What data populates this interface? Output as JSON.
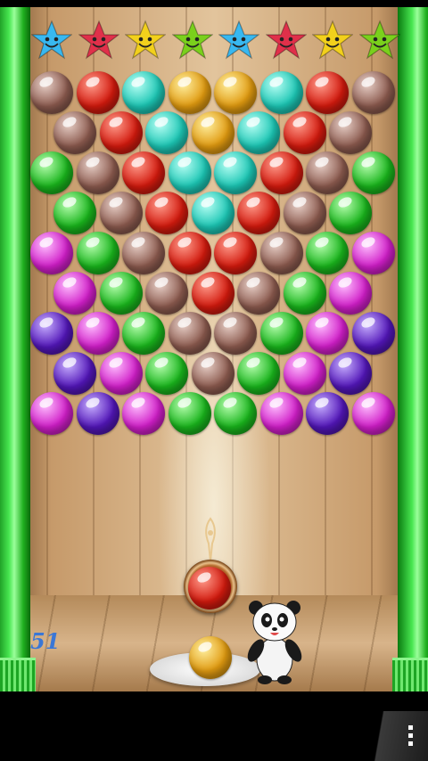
{
  "hud": {
    "shots_left": "51"
  },
  "stars": [
    "blue",
    "red",
    "yellow",
    "green",
    "blue",
    "red",
    "yellow",
    "green"
  ],
  "palette": {
    "brown": [
      "#e8d0c8",
      "#8b5a4e"
    ],
    "red": [
      "#ff9c8c",
      "#d21a0e"
    ],
    "teal": [
      "#b8fff4",
      "#1cc6b4"
    ],
    "gold": [
      "#fff0a0",
      "#e09a10"
    ],
    "green": [
      "#b8ffb0",
      "#19b41c"
    ],
    "magenta": [
      "#ffc0ff",
      "#d01ec8"
    ],
    "purple": [
      "#c8b0ff",
      "#5216b8"
    ],
    "star_blue": "#38b8f0",
    "star_red": "#e0304a",
    "star_yellow": "#f2d01c",
    "star_green": "#7ad01c"
  },
  "grid": [
    [
      "brown",
      "red",
      "teal",
      "gold",
      "gold",
      "teal",
      "red",
      "brown"
    ],
    [
      "brown",
      "red",
      "teal",
      "gold",
      "teal",
      "red",
      "brown"
    ],
    [
      "green",
      "brown",
      "red",
      "teal",
      "teal",
      "red",
      "brown",
      "green"
    ],
    [
      "green",
      "brown",
      "red",
      "teal",
      "red",
      "brown",
      "green"
    ],
    [
      "magenta",
      "green",
      "brown",
      "red",
      "red",
      "brown",
      "green",
      "magenta"
    ],
    [
      "magenta",
      "green",
      "brown",
      "red",
      "brown",
      "green",
      "magenta"
    ],
    [
      "purple",
      "magenta",
      "green",
      "brown",
      "brown",
      "green",
      "magenta",
      "purple"
    ],
    [
      "purple",
      "magenta",
      "green",
      "brown",
      "green",
      "magenta",
      "purple"
    ],
    [
      "magenta",
      "purple",
      "magenta",
      "green",
      "green",
      "magenta",
      "purple",
      "magenta"
    ]
  ],
  "shooter": {
    "current": "red",
    "next": "gold"
  }
}
